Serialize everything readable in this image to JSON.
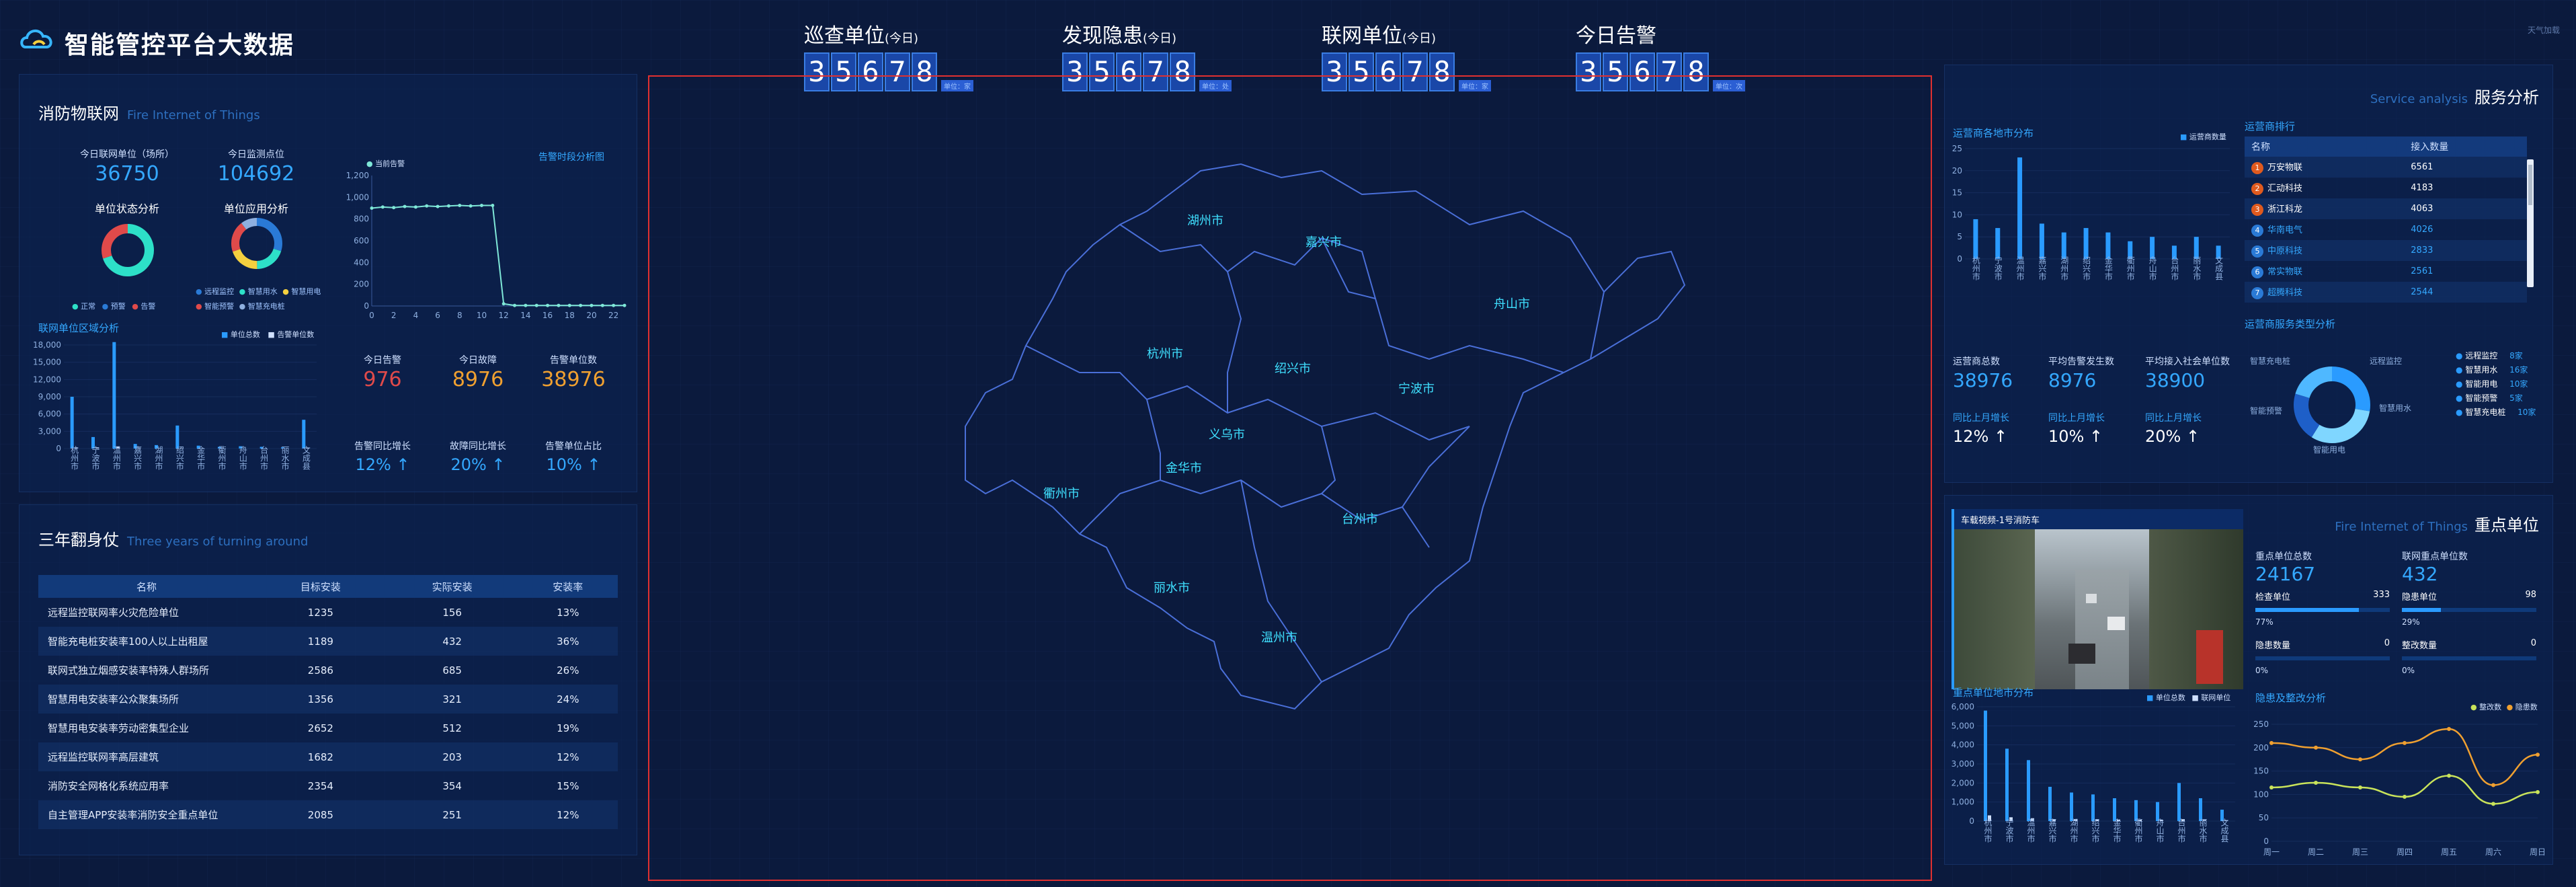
{
  "header": {
    "title": "智能管控平台大数据",
    "corner": "天气加载"
  },
  "kpis": [
    {
      "title": "巡查单位",
      "suffix": "(今日)",
      "digits": [
        "3",
        "5",
        "6",
        "7",
        "8"
      ],
      "tag": "单位：家"
    },
    {
      "title": "发现隐患",
      "suffix": "(今日)",
      "digits": [
        "3",
        "5",
        "6",
        "7",
        "8"
      ],
      "tag": "单位：处"
    },
    {
      "title": "联网单位",
      "suffix": "(今日)",
      "digits": [
        "3",
        "5",
        "6",
        "7",
        "8"
      ],
      "tag": "单位：家"
    },
    {
      "title": "今日告警",
      "suffix": "",
      "digits": [
        "3",
        "5",
        "6",
        "7",
        "8"
      ],
      "tag": "单位：次"
    }
  ],
  "iot": {
    "title": "消防物联网",
    "subtitle": "Fire Internet of Things",
    "stats": [
      {
        "label": "今日联网单位（场所）",
        "value": "36750"
      },
      {
        "label": "今日监测点位",
        "value": "104692"
      }
    ],
    "donut1": {
      "title": "单位状态分析",
      "legend": [
        "正常",
        "预警",
        "告警"
      ],
      "colors": [
        "#2de0c8",
        "#2a7ad6",
        "#e04a4a"
      ]
    },
    "donut2": {
      "title": "单位应用分析",
      "legend": [
        "远程监控",
        "智慧用水",
        "智慧用电",
        "智能预警",
        "智慧充电桩"
      ],
      "colors": [
        "#2a7ad6",
        "#2de0c8",
        "#f4d03f",
        "#e04a4a",
        "#8fb0e0"
      ]
    },
    "alarm_chart": {
      "title": "告警时段分析图",
      "legend": "当前告警",
      "yticks": [
        "1,200",
        "1,000",
        "800",
        "600",
        "400",
        "200",
        "0"
      ],
      "xticks": [
        "0",
        "2",
        "4",
        "6",
        "8",
        "10",
        "12",
        "14",
        "16",
        "18",
        "20",
        "22"
      ]
    },
    "region_chart": {
      "title": "联网单位区域分析",
      "legend": [
        "单位总数",
        "告警单位数"
      ],
      "yticks": [
        "18,000",
        "15,000",
        "12,000",
        "9,000",
        "6,000",
        "3,000",
        "0"
      ],
      "cities": [
        "杭州市",
        "宁波市",
        "温州市",
        "嘉兴市",
        "湖州市",
        "绍兴市",
        "金华市",
        "衢州市",
        "舟山市",
        "台州市",
        "丽水市",
        "文成县"
      ]
    },
    "today": [
      {
        "label": "今日告警",
        "value": "976",
        "color": "#e04a4a"
      },
      {
        "label": "今日故障",
        "value": "8976",
        "color": "#f0a030"
      },
      {
        "label": "告警单位数",
        "value": "38976",
        "color": "#f0a030"
      }
    ],
    "growth": [
      {
        "label": "告警同比增长",
        "value": "12% ↑"
      },
      {
        "label": "故障同比增长",
        "value": "20% ↑"
      },
      {
        "label": "告警单位占比",
        "value": "10% ↑"
      }
    ]
  },
  "three_year": {
    "title": "三年翻身仗",
    "subtitle": "Three years of turning around",
    "headers": [
      "名称",
      "目标安装",
      "实际安装",
      "安装率"
    ],
    "rows": [
      [
        "远程监控联网率火灾危险单位",
        "1235",
        "156",
        "13%"
      ],
      [
        "智能充电桩安装率100人以上出租屋",
        "1189",
        "432",
        "36%"
      ],
      [
        "联网式独立烟感安装率特殊人群场所",
        "2586",
        "685",
        "26%"
      ],
      [
        "智慧用电安装率公众聚集场所",
        "1356",
        "321",
        "24%"
      ],
      [
        "智慧用电安装率劳动密集型企业",
        "2652",
        "512",
        "19%"
      ],
      [
        "远程监控联网率高层建筑",
        "1682",
        "203",
        "12%"
      ],
      [
        "消防安全网格化系统应用率",
        "2354",
        "354",
        "15%"
      ],
      [
        "自主管理APP安装率消防安全重点单位",
        "2085",
        "251",
        "12%"
      ]
    ]
  },
  "map": {
    "cities": [
      "湖州市",
      "嘉兴市",
      "舟山市",
      "杭州市",
      "绍兴市",
      "宁波市",
      "义乌市",
      "金华市",
      "衢州市",
      "台州市",
      "丽水市",
      "温州市"
    ]
  },
  "service": {
    "title": "服务分析",
    "subtitle": "Service analysis",
    "dist_title": "运营商各地市分布",
    "dist_legend": "运营商数量",
    "dist_yticks": [
      "25",
      "20",
      "15",
      "10",
      "5",
      "0"
    ],
    "dist_cities": [
      "杭州市",
      "宁波市",
      "温州市",
      "嘉兴市",
      "湖州市",
      "绍兴市",
      "金华市",
      "衢州市",
      "舟山市",
      "台州市",
      "丽水市",
      "文成县"
    ],
    "rank_title": "运营商排行",
    "rank_headers": [
      "名称",
      "接入数量"
    ],
    "rank_rows": [
      [
        "1",
        "万安物联",
        "6561"
      ],
      [
        "2",
        "汇动科技",
        "4183"
      ],
      [
        "3",
        "浙江科龙",
        "4063"
      ],
      [
        "4",
        "华南电气",
        "4026"
      ],
      [
        "5",
        "中原科技",
        "2833"
      ],
      [
        "6",
        "常实物联",
        "2561"
      ],
      [
        "7",
        "超腾科技",
        "2544"
      ]
    ],
    "stats": [
      {
        "label": "运营商总数",
        "value": "38976"
      },
      {
        "label": "平均告警发生数",
        "value": "8976"
      },
      {
        "label": "平均接入社会单位数",
        "value": "38900"
      }
    ],
    "growth": [
      {
        "label": "同比上月增长",
        "value": "12% ↑"
      },
      {
        "label": "同比上月增长",
        "value": "10% ↑"
      },
      {
        "label": "同比上月增长",
        "value": "20% ↑"
      }
    ],
    "type_title": "运营商服务类型分析",
    "type_legend": [
      {
        "name": "远程监控",
        "value": "8家"
      },
      {
        "name": "智慧用水",
        "value": "16家"
      },
      {
        "name": "智能用电",
        "value": "10家"
      },
      {
        "name": "智能预警",
        "value": "5家"
      },
      {
        "name": "智慧充电桩",
        "value": "10家"
      }
    ],
    "donut_labels": [
      "智慧充电桩",
      "远程监控",
      "智能预警",
      "智慧用水",
      "智能用电"
    ]
  },
  "key_units": {
    "title": "重点单位",
    "subtitle": "Fire Internet of Things",
    "video_title": "车载视频-1号消防车",
    "stats": [
      {
        "label": "重点单位总数",
        "value": "24167"
      },
      {
        "label": "联网重点单位数",
        "value": "432"
      }
    ],
    "bars": [
      {
        "label": "检查单位",
        "value": "333",
        "pct": "77%",
        "fill": 0.77
      },
      {
        "label": "隐患单位",
        "value": "98",
        "pct": "29%",
        "fill": 0.29
      },
      {
        "label": "隐患数量",
        "value": "0",
        "pct": "0%",
        "fill": 0
      },
      {
        "label": "整改数量",
        "value": "0",
        "pct": "0%",
        "fill": 0
      }
    ],
    "dist_title": "重点单位地市分布",
    "dist_legend": [
      "单位总数",
      "联网单位"
    ],
    "dist_yticks": [
      "6,000",
      "5,000",
      "4,000",
      "3,000",
      "2,000",
      "1,000",
      "0"
    ],
    "dist_cities": [
      "杭州市",
      "宁波市",
      "温州市",
      "嘉兴市",
      "湖州市",
      "绍兴市",
      "金华市",
      "衢州市",
      "舟山市",
      "台州市",
      "丽水市",
      "文成县"
    ],
    "hazard_title": "隐患及整改分析",
    "hazard_legend": [
      "整改数",
      "隐患数"
    ],
    "hazard_yticks": [
      "250",
      "200",
      "150",
      "100",
      "50",
      "0"
    ],
    "hazard_x": [
      "周一",
      "周二",
      "周三",
      "周四",
      "周五",
      "周六",
      "周日"
    ]
  },
  "chart_data": [
    {
      "type": "line",
      "title": "告警时段分析图",
      "series": [
        {
          "name": "当前告警",
          "x": [
            0,
            1,
            2,
            3,
            4,
            5,
            6,
            7,
            8,
            9,
            10,
            11,
            12,
            13,
            14,
            15,
            16,
            17,
            18,
            19,
            20,
            21,
            22,
            23
          ],
          "values": [
            900,
            910,
            905,
            915,
            910,
            920,
            915,
            920,
            925,
            920,
            925,
            925,
            20,
            5,
            5,
            5,
            5,
            5,
            5,
            5,
            5,
            5,
            5,
            5
          ]
        }
      ],
      "ylim": [
        0,
        1200
      ]
    },
    {
      "type": "bar",
      "title": "联网单位区域分析",
      "categories": [
        "杭州市",
        "宁波市",
        "温州市",
        "嘉兴市",
        "湖州市",
        "绍兴市",
        "金华市",
        "衢州市",
        "舟山市",
        "台州市",
        "丽水市",
        "文成县"
      ],
      "series": [
        {
          "name": "单位总数",
          "values": [
            9000,
            2000,
            18500,
            800,
            600,
            4000,
            500,
            300,
            400,
            300,
            200,
            5000
          ]
        },
        {
          "name": "告警单位数",
          "values": [
            200,
            100,
            300,
            50,
            30,
            80,
            20,
            10,
            20,
            10,
            10,
            100
          ]
        }
      ],
      "ylim": [
        0,
        18000
      ]
    },
    {
      "type": "bar",
      "title": "运营商各地市分布",
      "categories": [
        "杭州市",
        "宁波市",
        "温州市",
        "嘉兴市",
        "湖州市",
        "绍兴市",
        "金华市",
        "衢州市",
        "舟山市",
        "台州市",
        "丽水市",
        "文成县"
      ],
      "series": [
        {
          "name": "运营商数量",
          "values": [
            9,
            7,
            23,
            8,
            6,
            7,
            6,
            4,
            5,
            3,
            5,
            3
          ]
        }
      ],
      "ylim": [
        0,
        25
      ]
    },
    {
      "type": "bar",
      "title": "重点单位地市分布",
      "categories": [
        "杭州市",
        "宁波市",
        "温州市",
        "嘉兴市",
        "湖州市",
        "绍兴市",
        "金华市",
        "衢州市",
        "舟山市",
        "台州市",
        "丽水市",
        "文成县"
      ],
      "series": [
        {
          "name": "单位总数",
          "values": [
            5800,
            3800,
            3200,
            1800,
            1500,
            1400,
            1200,
            1100,
            1000,
            2000,
            1200,
            600
          ]
        },
        {
          "name": "联网单位",
          "values": [
            300,
            200,
            150,
            100,
            100,
            80,
            80,
            70,
            60,
            100,
            60,
            30
          ]
        }
      ],
      "ylim": [
        0,
        6000
      ]
    },
    {
      "type": "line",
      "title": "隐患及整改分析",
      "categories": [
        "周一",
        "周二",
        "周三",
        "周四",
        "周五",
        "周六",
        "周日"
      ],
      "series": [
        {
          "name": "整改数",
          "values": [
            115,
            125,
            115,
            95,
            140,
            80,
            105
          ]
        },
        {
          "name": "隐患数",
          "values": [
            210,
            200,
            175,
            210,
            240,
            120,
            185
          ]
        }
      ],
      "ylim": [
        0,
        250
      ]
    }
  ]
}
